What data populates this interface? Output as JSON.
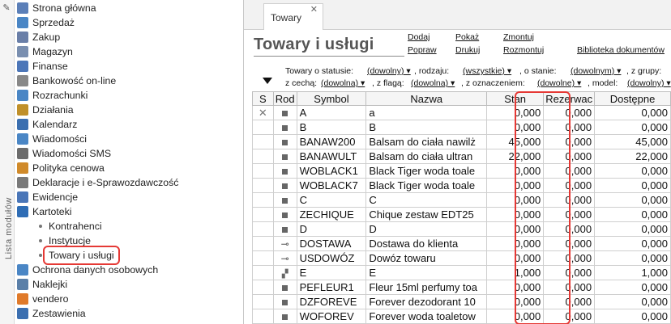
{
  "sidebar": {
    "vertical_label": "Lista modułów",
    "modules": [
      {
        "label": "Strona główna",
        "icon": "home-icon",
        "color": "#5b7fb8"
      },
      {
        "label": "Sprzedaż",
        "icon": "sales-icon",
        "color": "#4a86c5"
      },
      {
        "label": "Zakup",
        "icon": "purchase-icon",
        "color": "#6a7fa8"
      },
      {
        "label": "Magazyn",
        "icon": "warehouse-icon",
        "color": "#7a8fb0"
      },
      {
        "label": "Finanse",
        "icon": "finance-icon",
        "color": "#4c76b8"
      },
      {
        "label": "Bankowość on-line",
        "icon": "bank-icon",
        "color": "#888888"
      },
      {
        "label": "Rozrachunki",
        "icon": "settlements-icon",
        "color": "#4a86c5"
      },
      {
        "label": "Działania",
        "icon": "actions-icon",
        "color": "#c0902a"
      },
      {
        "label": "Kalendarz",
        "icon": "calendar-icon",
        "color": "#3b6fb0"
      },
      {
        "label": "Wiadomości",
        "icon": "messages-icon",
        "color": "#4a86c5"
      },
      {
        "label": "Wiadomości SMS",
        "icon": "sms-icon",
        "color": "#6c6c6c"
      },
      {
        "label": "Polityka cenowa",
        "icon": "pricing-icon",
        "color": "#d08a2a"
      },
      {
        "label": "Deklaracje i e-Sprawozdawczość",
        "icon": "declarations-icon",
        "color": "#7a7a7a"
      },
      {
        "label": "Ewidencje",
        "icon": "records-icon",
        "color": "#4a76b8"
      },
      {
        "label": "Kartoteki",
        "icon": "card-files-icon",
        "color": "#2f6db5"
      }
    ],
    "subitems": [
      {
        "label": "Kontrahenci"
      },
      {
        "label": "Instytucje"
      },
      {
        "label": "Towary i usługi",
        "selected": true
      }
    ],
    "modules_after": [
      {
        "label": "Ochrona danych osobowych",
        "icon": "data-protection-icon",
        "color": "#4a86c5"
      },
      {
        "label": "Naklejki",
        "icon": "labels-icon",
        "color": "#5a7fa8"
      },
      {
        "label": "vendero",
        "icon": "vendero-icon",
        "color": "#e07a2a"
      },
      {
        "label": "Zestawienia",
        "icon": "reports-icon",
        "color": "#3b6fb0"
      }
    ]
  },
  "tabs": [
    {
      "label": "Towary",
      "close": "✕"
    }
  ],
  "page": {
    "title": "Towary i usługi",
    "actions": {
      "dodaj": "Dodaj",
      "popraw": "Popraw",
      "pokaz": "Pokaż",
      "drukuj": "Drukuj",
      "zmontuj": "Zmontuj",
      "rozmontuj": "Rozmontuj",
      "biblioteka": "Biblioteka dokumentów"
    }
  },
  "filters": {
    "row1": [
      {
        "label": "Towary o statusie:",
        "value": "(dowolny) ▾"
      },
      {
        "label": ", rodzaju:",
        "value": "(wszystkie) ▾"
      },
      {
        "label": ", o stanie:",
        "value": "(dowolnym) ▾"
      },
      {
        "label": ", z grupy:",
        "value": ""
      }
    ],
    "row2": [
      {
        "label": "z cechą:",
        "value": "(dowolna) ▾"
      },
      {
        "label": ", z flagą:",
        "value": "(dowolna) ▾"
      },
      {
        "label": ", z oznaczeniem:",
        "value": "(dowolne) ▾"
      },
      {
        "label": ", model:",
        "value": "(dowolny) ▾"
      }
    ]
  },
  "table": {
    "columns": [
      "S",
      "Rod",
      "Symbol",
      "Nazwa",
      "Stan",
      "Rezerwac",
      "Dostępne"
    ],
    "rows": [
      {
        "s": "✕",
        "rod": "square-icon",
        "symbol": "A",
        "nazwa": "a",
        "stan": "0,000",
        "rez": "0,000",
        "dost": "0,000"
      },
      {
        "s": "",
        "rod": "square-icon",
        "symbol": "B",
        "nazwa": "B",
        "stan": "0,000",
        "rez": "0,000",
        "dost": "0,000"
      },
      {
        "s": "",
        "rod": "square-icon",
        "symbol": "BANAW200",
        "nazwa": "Balsam do ciała nawilż",
        "stan": "45,000",
        "rez": "0,000",
        "dost": "45,000"
      },
      {
        "s": "",
        "rod": "square-icon",
        "symbol": "BANAWULT",
        "nazwa": "Balsam do ciała ultran",
        "stan": "22,000",
        "rez": "0,000",
        "dost": "22,000"
      },
      {
        "s": "",
        "rod": "square-icon",
        "symbol": "WOBLACK1",
        "nazwa": "Black Tiger woda toale",
        "stan": "0,000",
        "rez": "0,000",
        "dost": "0,000"
      },
      {
        "s": "",
        "rod": "square-icon",
        "symbol": "WOBLACK7",
        "nazwa": "Black Tiger woda toale",
        "stan": "0,000",
        "rez": "0,000",
        "dost": "0,000"
      },
      {
        "s": "",
        "rod": "square-icon",
        "symbol": "C",
        "nazwa": "C",
        "stan": "0,000",
        "rez": "0,000",
        "dost": "0,000"
      },
      {
        "s": "",
        "rod": "square-icon",
        "symbol": "ZECHIQUE",
        "nazwa": "Chique zestaw EDT25",
        "stan": "0,000",
        "rez": "0,000",
        "dost": "0,000"
      },
      {
        "s": "",
        "rod": "square-icon",
        "symbol": "D",
        "nazwa": "D",
        "stan": "0,000",
        "rez": "0,000",
        "dost": "0,000"
      },
      {
        "s": "",
        "rod": "service-wrench-icon",
        "symbol": "DOSTAWA",
        "nazwa": "Dostawa do klienta",
        "stan": "0,000",
        "rez": "0,000",
        "dost": "0,000"
      },
      {
        "s": "",
        "rod": "service-wrench-icon",
        "symbol": "USDOWÓZ",
        "nazwa": "Dowóz towaru",
        "stan": "0,000",
        "rez": "0,000",
        "dost": "0,000"
      },
      {
        "s": "",
        "rod": "set-icon",
        "symbol": "E",
        "nazwa": "E",
        "stan": "1,000",
        "rez": "0,000",
        "dost": "1,000"
      },
      {
        "s": "",
        "rod": "square-icon",
        "symbol": "PEFLEUR1",
        "nazwa": "Fleur 15ml perfumy toa",
        "stan": "0,000",
        "rez": "0,000",
        "dost": "0,000"
      },
      {
        "s": "",
        "rod": "square-icon",
        "symbol": "DZFOREVE",
        "nazwa": "Forever dezodorant 10",
        "stan": "0,000",
        "rez": "0,000",
        "dost": "0,000"
      },
      {
        "s": "",
        "rod": "square-icon",
        "symbol": "WOFOREV",
        "nazwa": "Forever woda toaletow",
        "stan": "0,000",
        "rez": "0,000",
        "dost": "0,000"
      }
    ]
  }
}
